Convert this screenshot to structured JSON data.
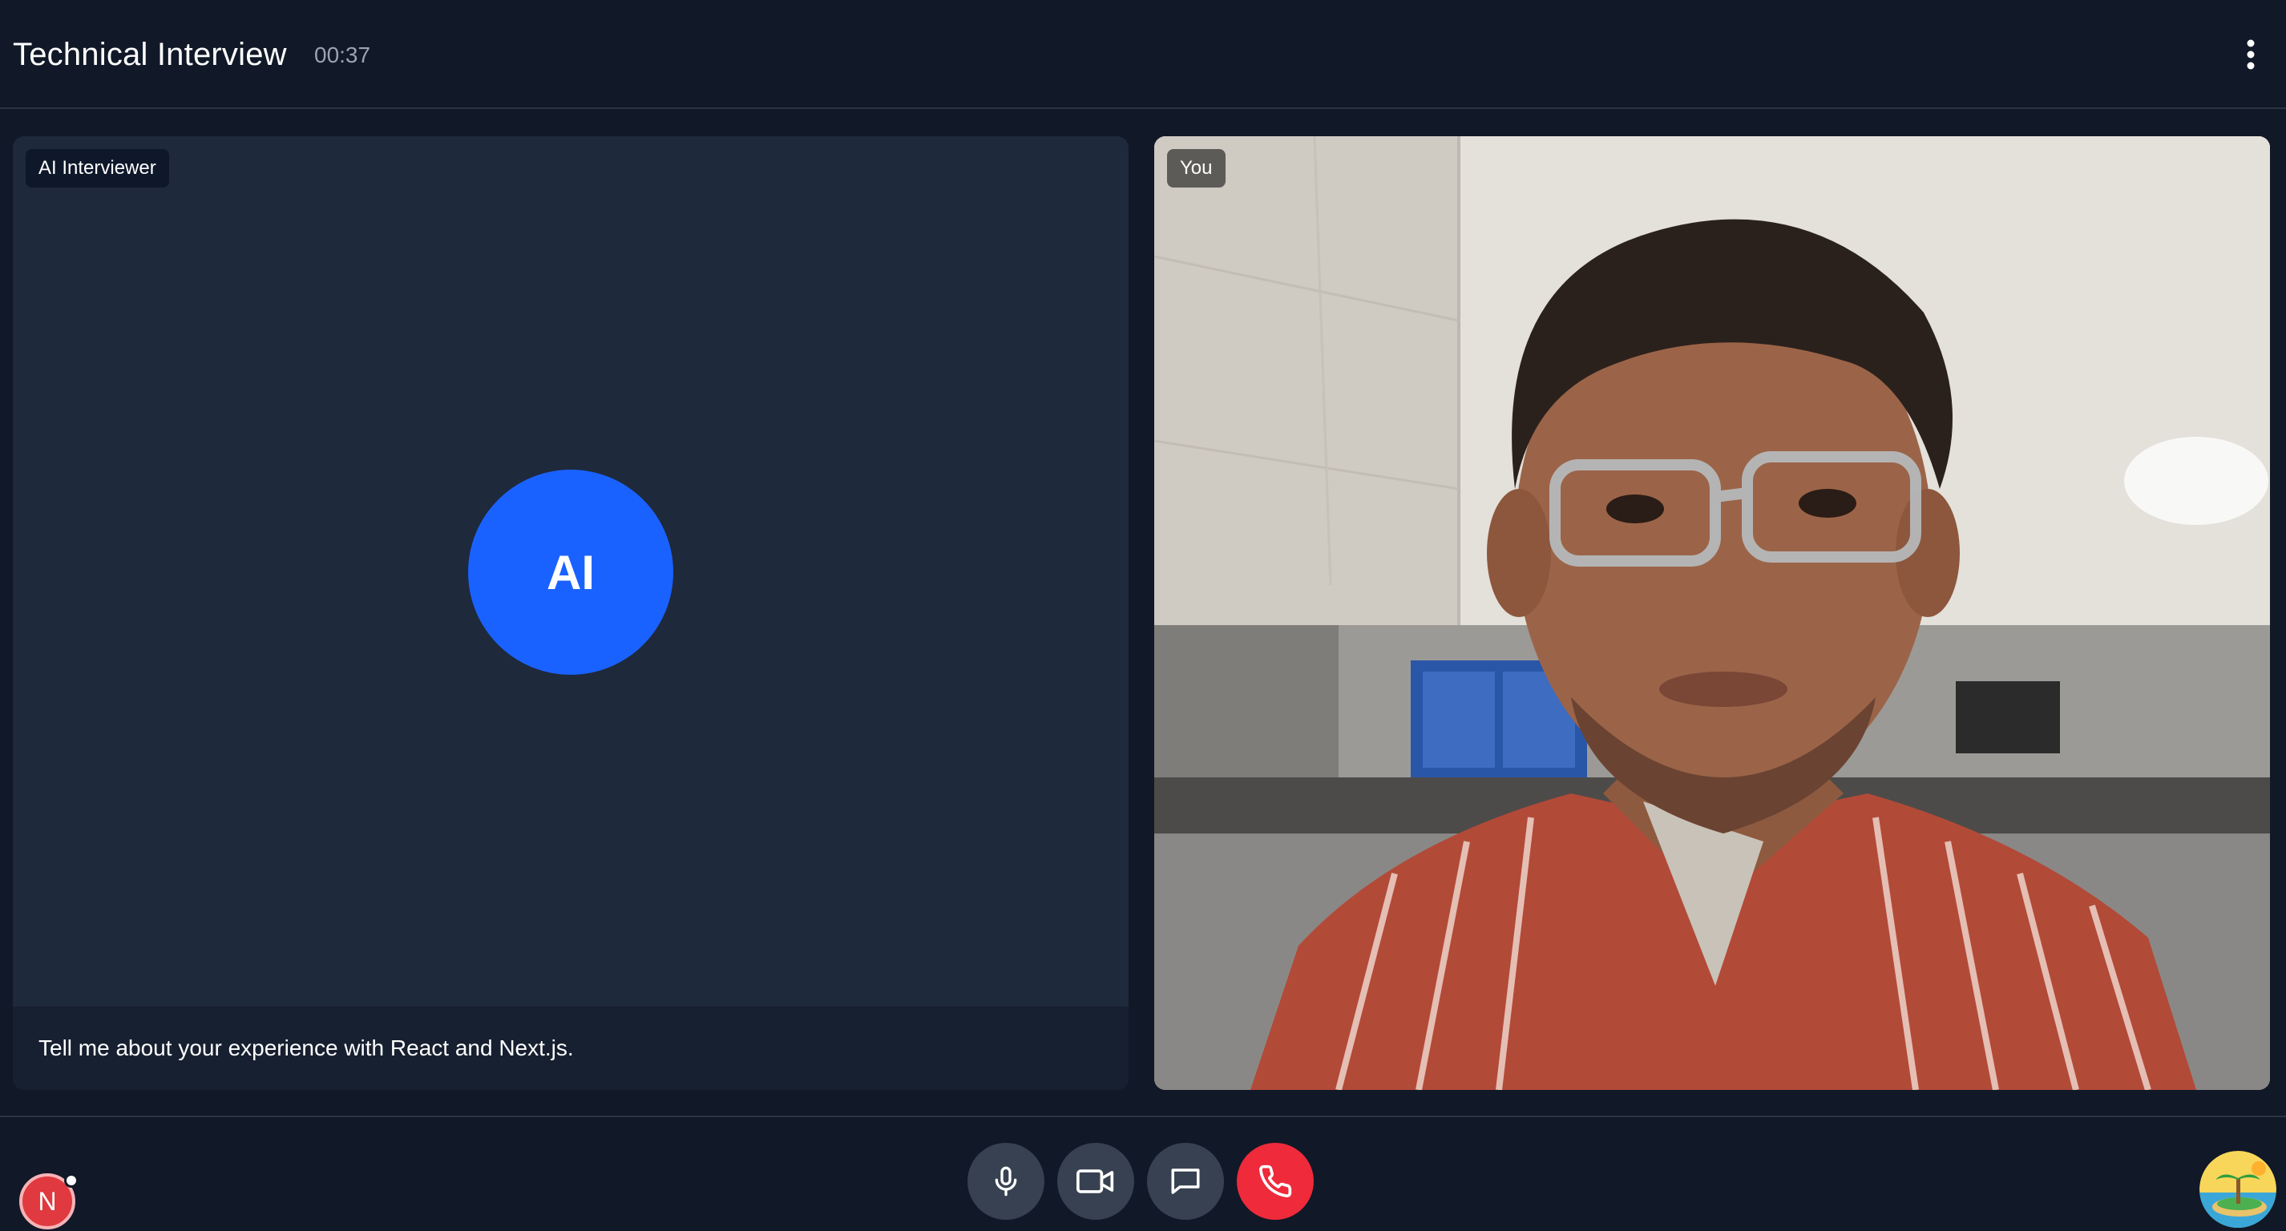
{
  "header": {
    "title": "Technical Interview",
    "timer": "00:37",
    "menu_icon": "more-vertical-icon"
  },
  "ai_panel": {
    "tag": "AI Interviewer",
    "avatar_text": "AI",
    "avatar_color": "#1a62ff",
    "caption": "Tell me about your experience with React and Next.js."
  },
  "you_panel": {
    "tag": "You"
  },
  "controls": {
    "mic_icon": "microphone-icon",
    "camera_icon": "video-camera-icon",
    "chat_icon": "chat-bubble-icon",
    "end_call_icon": "phone-icon",
    "end_call_color": "#ef2a3a"
  },
  "badges": {
    "nextjs_letter": "N",
    "extension_icon": "beach-island-icon"
  }
}
